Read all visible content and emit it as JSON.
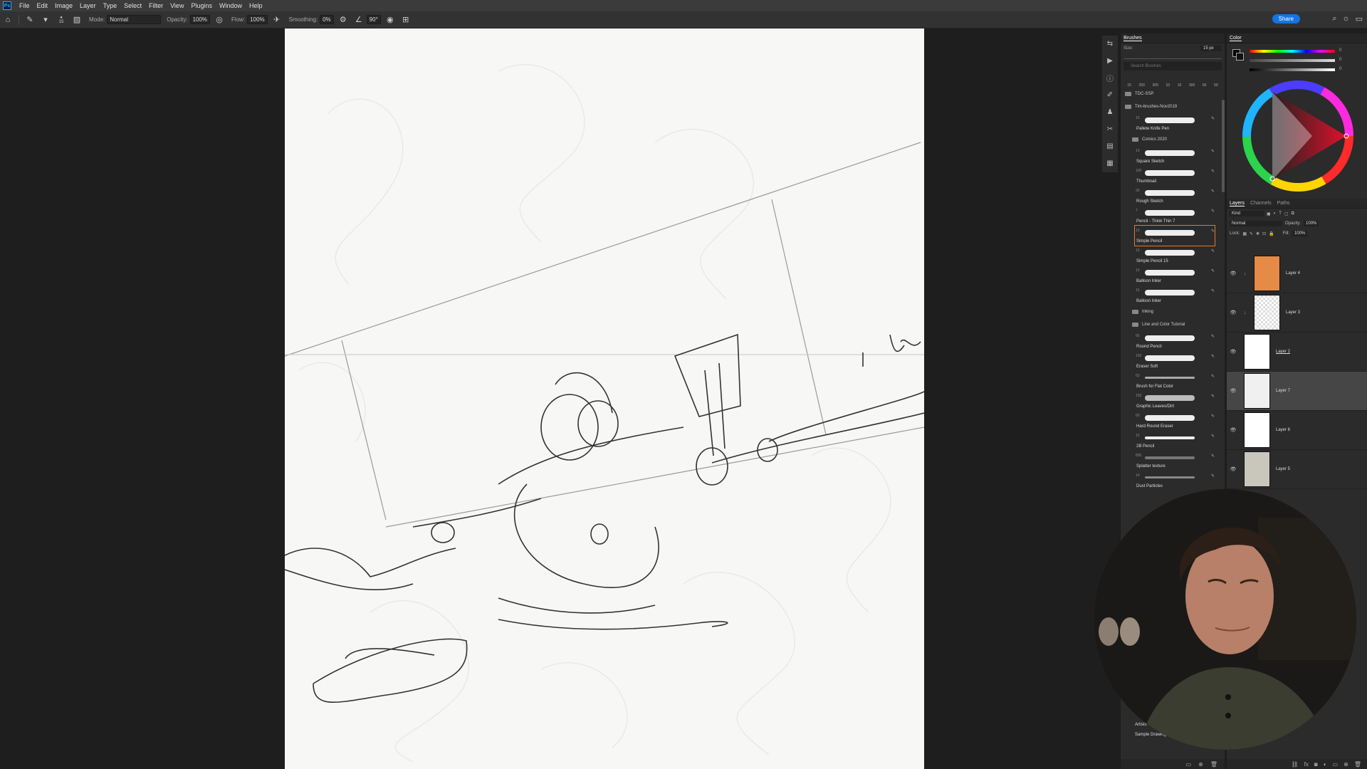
{
  "menu": [
    "File",
    "Edit",
    "Image",
    "Layer",
    "Type",
    "Select",
    "Filter",
    "View",
    "Plugins",
    "Window",
    "Help"
  ],
  "options": {
    "brush_size": "15",
    "mode_label": "Mode:",
    "mode_value": "Normal",
    "opacity_label": "Opacity:",
    "opacity_value": "100%",
    "flow_label": "Flow:",
    "flow_value": "100%",
    "smoothing_label": "Smoothing:",
    "smoothing_value": "0%",
    "angle_value": "90°",
    "share_label": "Share"
  },
  "brushes_panel": {
    "title": "Brushes",
    "size_label": "Size:",
    "size_value": "15 px",
    "search_placeholder": "Search Brushes",
    "preset_sizes": [
      "15",
      "250",
      "300",
      "10",
      "10",
      "300",
      "60",
      "60"
    ],
    "groups": [
      {
        "name": "TDC-SSP",
        "items": []
      },
      {
        "name": "Tim-brushes-Nov2019",
        "items": [
          {
            "num": "15",
            "name": "Pallete Knife Pen"
          }
        ]
      },
      {
        "name": "Comics 2020",
        "items": [
          {
            "num": "10",
            "name": "Square Sketch"
          },
          {
            "num": "100",
            "name": "Thumbnail"
          },
          {
            "num": "30",
            "name": "Rough Sketch"
          },
          {
            "num": "7",
            "name": "Pencil - Think Thin 7"
          },
          {
            "num": "15",
            "name": "Simple Pencil",
            "selected": true
          },
          {
            "num": "15",
            "name": "Simple Pencil 15"
          },
          {
            "num": "15",
            "name": "Balloon Inker"
          },
          {
            "num": "15",
            "name": "Balloon Inker"
          }
        ]
      },
      {
        "name": "Inking",
        "items": []
      },
      {
        "name": "Line and Color Tutorial",
        "items": [
          {
            "num": "65",
            "name": "Round Pencil"
          },
          {
            "num": "150",
            "name": "Eraser Soft"
          },
          {
            "num": "63",
            "name": "Brush for Flat Color"
          },
          {
            "num": "150",
            "name": "Graphic Leaves/Dirt"
          },
          {
            "num": "60",
            "name": "Hard Round Eraser"
          },
          {
            "num": "15",
            "name": "2B Pencil"
          },
          {
            "num": "800",
            "name": "Splatter texture"
          },
          {
            "num": "14",
            "name": "Dust Particles"
          }
        ]
      }
    ],
    "tail_items": [
      "Artists",
      "Sample Drawing Brush"
    ]
  },
  "color_panel": {
    "title": "Color",
    "sliders": [
      "0",
      "0",
      "0"
    ]
  },
  "layers_panel": {
    "tabs": [
      "Layers",
      "Channels",
      "Paths"
    ],
    "kind_label": "Kind",
    "blend_mode": "Normal",
    "opacity_label": "Opacity:",
    "opacity_value": "100%",
    "lock_label": "Lock:",
    "fill_label": "Fill:",
    "fill_value": "100%",
    "layers": [
      {
        "name": "Layer 4"
      },
      {
        "name": "Layer 3"
      },
      {
        "name": "Layer 2"
      },
      {
        "name": "Layer 7",
        "selected": true
      },
      {
        "name": "Layer 6"
      },
      {
        "name": "Layer 5"
      }
    ]
  },
  "colors": {
    "accent": "#1473e6",
    "layer4_fill": "#e68b45",
    "selected_brush_border": "#e07a2f"
  }
}
